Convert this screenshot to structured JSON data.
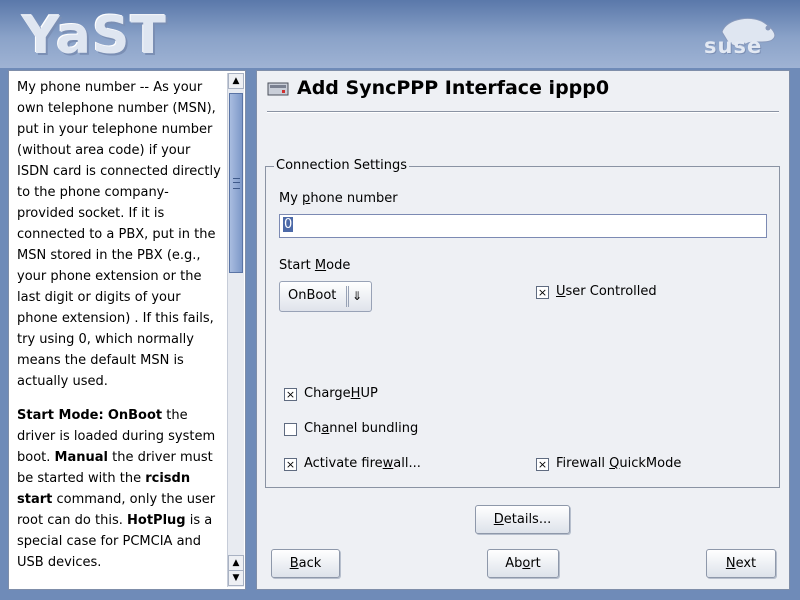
{
  "banner": {
    "product_logo": "YaST",
    "vendor_logo": "suse"
  },
  "help": {
    "para1": "My phone number -- As your own telephone number (MSN), put in your telephone number (without area code) if your ISDN card is connected directly to the phone company-provided socket. If it is connected to a PBX, put in the MSN stored in the PBX (e.g., your phone extension or the last digit or digits of your phone extension) . If this fails, try using 0, which normally means the default MSN is actually used.",
    "para2": {
      "b1": "Start Mode:",
      "b2": "OnBoot",
      "t1": " the driver is loaded during system boot. ",
      "b3": "Manual",
      "t2": " the driver must be started with the ",
      "b4": "rcisdn start",
      "t3": " command, only the user root can do this. ",
      "b5": "HotPlug",
      "t4": " is a special case for PCMCIA and USB devices."
    }
  },
  "dialog": {
    "title": "Add SyncPPP Interface ippp0",
    "group_legend": "Connection Settings",
    "phone_label": {
      "pre": "My ",
      "u": "p",
      "post": "hone number"
    },
    "phone_value": "0",
    "start_mode_label": {
      "pre": "Start ",
      "u": "M",
      "post": "ode"
    },
    "start_mode_value": "OnBoot",
    "user_controlled": {
      "pre": "",
      "u": "U",
      "post": "ser Controlled",
      "checked": true
    },
    "charge_hup": {
      "pre": "Charge",
      "u": "H",
      "post": "UP",
      "checked": true
    },
    "channel_bundling": {
      "pre": "Ch",
      "u": "a",
      "post": "nnel bundling",
      "checked": false
    },
    "activate_firewall": {
      "pre": "Activate fire",
      "u": "w",
      "post": "all...",
      "checked": true
    },
    "firewall_quickmode": {
      "pre": "Firewall ",
      "u": "Q",
      "post": "uickMode",
      "checked": true
    },
    "details_button": {
      "pre": "",
      "u": "D",
      "post": "etails..."
    },
    "back_button": {
      "pre": "",
      "u": "B",
      "post": "ack"
    },
    "abort_button": {
      "pre": "Ab",
      "u": "o",
      "post": "rt"
    },
    "next_button": {
      "pre": "",
      "u": "N",
      "post": "ext"
    }
  },
  "icons": {
    "title_icon": "network-card-icon",
    "check_mark": "×",
    "scroll_up": "▲",
    "scroll_down": "▼",
    "combo_arrow": "⇓"
  },
  "colors": {
    "banner": "#6f8bb8",
    "selection": "#4d6aa8",
    "dialog_bg": "#eef0f4"
  }
}
